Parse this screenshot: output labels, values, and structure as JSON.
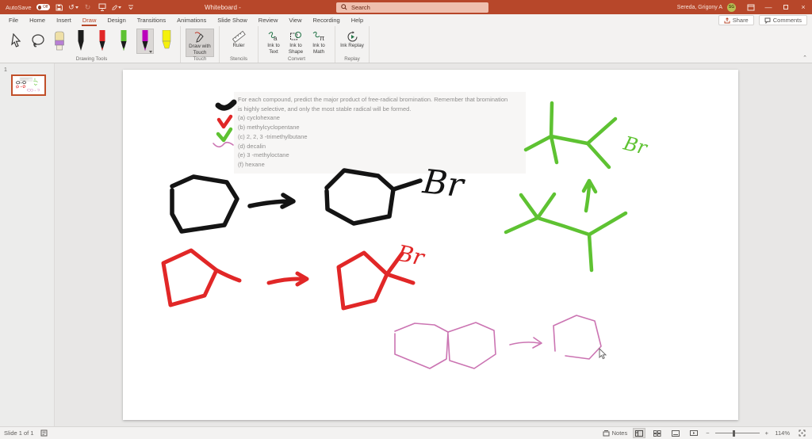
{
  "titlebar": {
    "autosave_label": "AutoSave",
    "autosave_state": "Off",
    "title": "Whiteboard -",
    "search_placeholder": "Search",
    "user_name": "Sereda, Grigony A",
    "user_initials": "SG"
  },
  "menubar": {
    "tabs": [
      "File",
      "Home",
      "Insert",
      "Draw",
      "Design",
      "Transitions",
      "Animations",
      "Slide Show",
      "Review",
      "View",
      "Recording",
      "Help"
    ],
    "active_tab": "Draw",
    "share_label": "Share",
    "comments_label": "Comments"
  },
  "ribbon": {
    "group_labels": {
      "drawing_tools": "Drawing Tools",
      "touch": "Touch",
      "stencils": "Stencils",
      "convert": "Convert",
      "replay": "Replay"
    },
    "buttons": {
      "draw_with_touch": "Draw with Touch",
      "ruler": "Ruler",
      "ink_to_text": "Ink to Text",
      "ink_to_shape": "Ink to Shape",
      "ink_to_math": "Ink to Math",
      "ink_replay": "Ink Replay"
    },
    "pen_colors": {
      "black": "#1c1c1c",
      "red": "#e12727",
      "green": "#5ec232",
      "magenta": "#bb00bb",
      "highlighter": "#f5f10c",
      "eraser_top": "#efe0a8",
      "eraser_band": "#b87fd4"
    }
  },
  "slide_panel": {
    "slide_number": "1"
  },
  "slide": {
    "problem_lines": [
      "For each compound, predict the major product of free-radical bromination. Remember that bromination",
      "is highly selective, and only the most stable radical will be formed.",
      "(a) cyclohexane",
      "(b) methylcyclopentane",
      "(c) 2, 2, 3 -trimethylbutane",
      "(d) decalin",
      "(e) 3 -methyloctane",
      "(f) hexane"
    ],
    "ink_colors": {
      "black": "#141414",
      "red": "#e12727",
      "green": "#5ec232",
      "pink": "#cb74b2"
    },
    "labels": {
      "black_br": "Br",
      "red_br": "Br",
      "green_br": "Br"
    }
  },
  "statusbar": {
    "slide_indicator": "Slide 1 of 1",
    "notes_label": "Notes",
    "zoom_level": "114%"
  }
}
